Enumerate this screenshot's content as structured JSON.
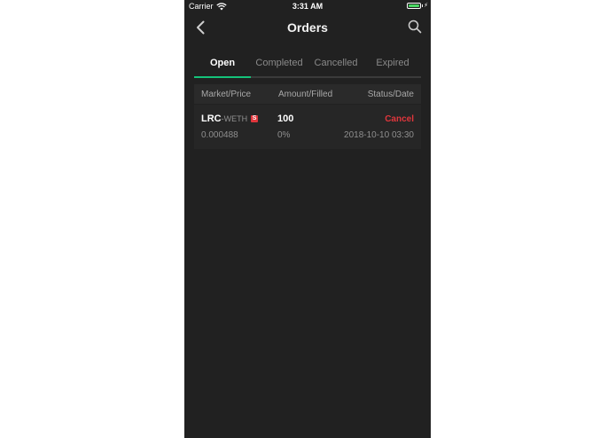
{
  "status_bar": {
    "carrier": "Carrier",
    "time": "3:31 AM",
    "battery_level": 1.0
  },
  "nav": {
    "title": "Orders",
    "back_icon": "chevron-left-icon",
    "search_icon": "search-icon"
  },
  "tabs": [
    {
      "label": "Open",
      "active": true
    },
    {
      "label": "Completed",
      "active": false
    },
    {
      "label": "Cancelled",
      "active": false
    },
    {
      "label": "Expired",
      "active": false
    }
  ],
  "table": {
    "headers": {
      "market": "Market/Price",
      "amount": "Amount/Filled",
      "status": "Status/Date"
    },
    "rows": [
      {
        "market_base": "LRC",
        "market_quote": "-WETH",
        "side": "S",
        "price": "0.000488",
        "amount": "100",
        "filled": "0%",
        "action": "Cancel",
        "date": "2018-10-10 03:30"
      }
    ]
  },
  "colors": {
    "background": "#212121",
    "accent": "#14c37a",
    "sell": "#e0363c",
    "battery": "#4cd964"
  }
}
